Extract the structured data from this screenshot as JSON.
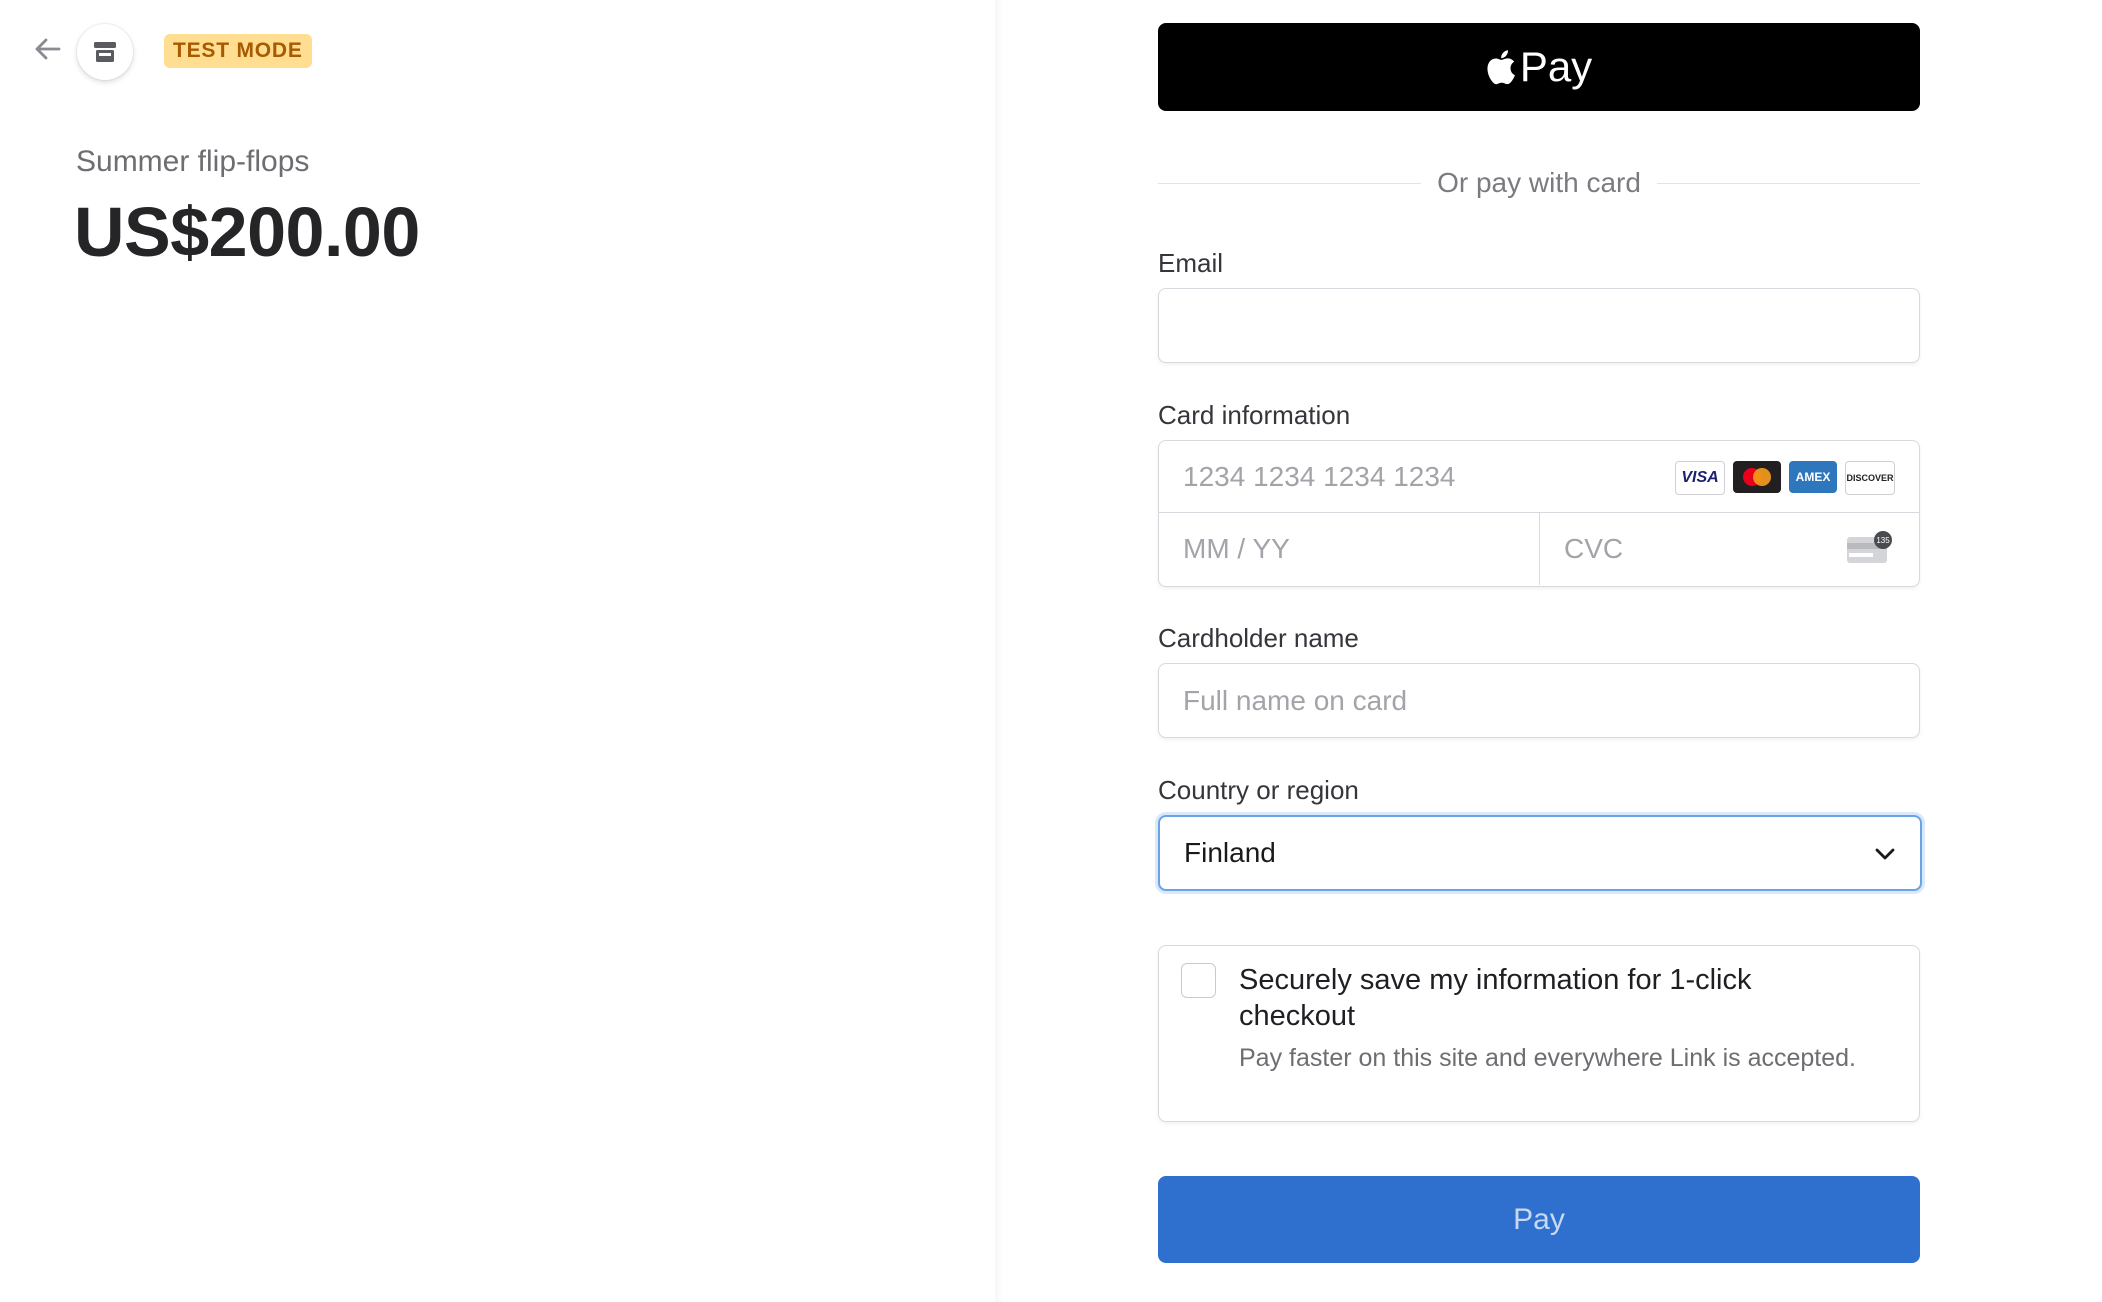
{
  "header": {
    "back_icon": "arrow-left-icon",
    "store_icon": "storefront-icon",
    "test_mode_label": "TEST MODE"
  },
  "product": {
    "name": "Summer flip-flops",
    "price": "US$200.00"
  },
  "payment": {
    "apple_pay_label": "Pay",
    "divider_text": "Or pay with card",
    "email": {
      "label": "Email",
      "value": "",
      "placeholder": ""
    },
    "card": {
      "label": "Card information",
      "number_placeholder": "1234 1234 1234 1234",
      "expiry_placeholder": "MM / YY",
      "cvc_placeholder": "CVC",
      "brands": [
        "VISA",
        "mastercard",
        "AMEX",
        "DISCOVER"
      ],
      "cvc_hint": "135"
    },
    "cardholder": {
      "label": "Cardholder name",
      "placeholder": "Full name on card"
    },
    "country": {
      "label": "Country or region",
      "selected": "Finland"
    },
    "save_info": {
      "checked": false,
      "title": "Securely save my information for 1-click checkout",
      "description": "Pay faster on this site and everywhere Link is accepted."
    },
    "pay_button_label": "Pay"
  },
  "colors": {
    "test_badge_bg": "#ffde92",
    "test_badge_text": "#a85a00",
    "pay_button": "#2f70cf",
    "focus_ring": "#6aa4e6",
    "apple_pay_bg": "#000000"
  }
}
